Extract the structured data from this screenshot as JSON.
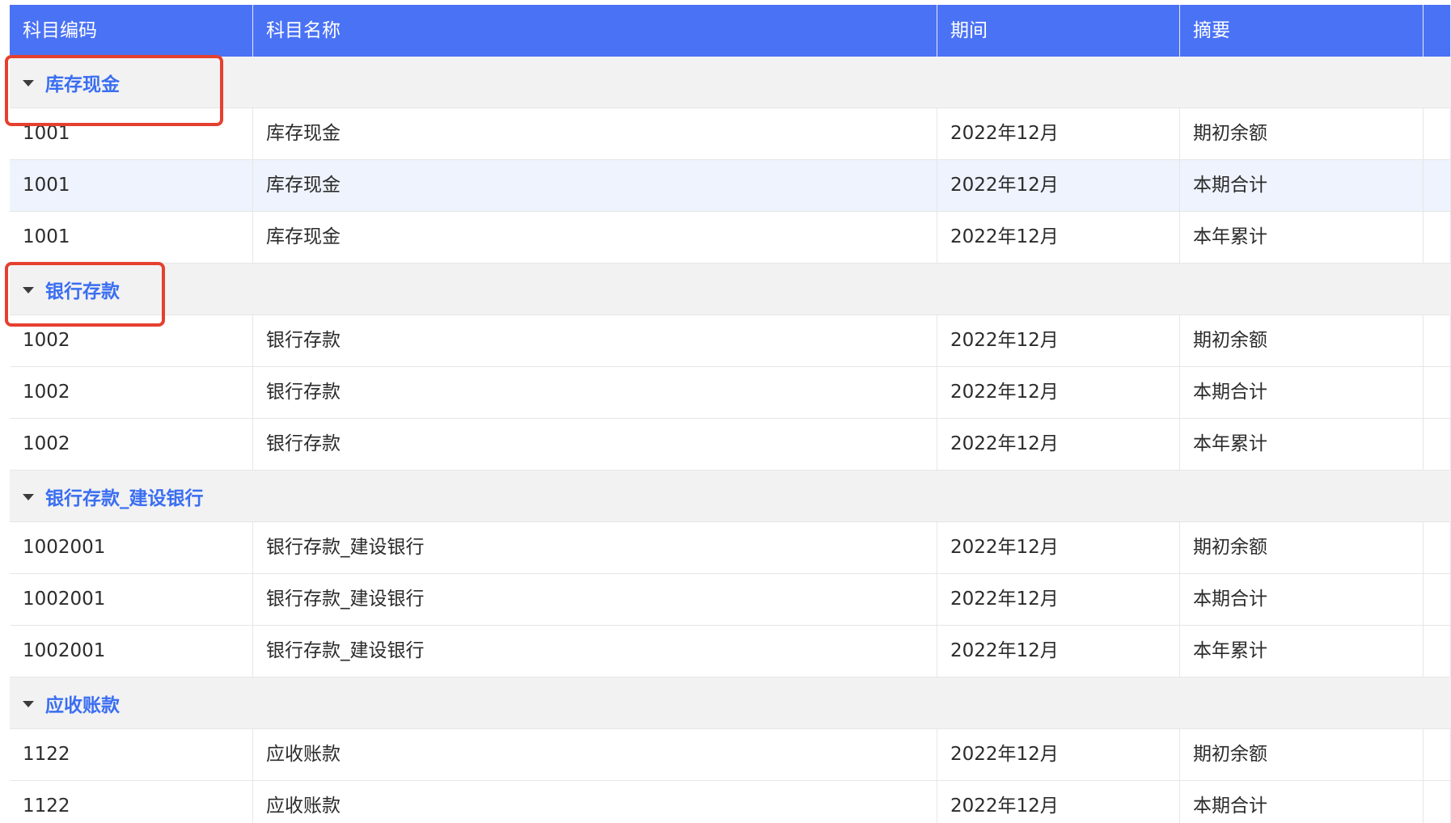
{
  "columns": [
    "科目编码",
    "科目名称",
    "期间",
    "摘要",
    ""
  ],
  "groups": [
    {
      "label": "库存现金",
      "rows": [
        {
          "code": "1001",
          "name": "库存现金",
          "period": "2022年12月",
          "summary": "期初余额"
        },
        {
          "code": "1001",
          "name": "库存现金",
          "period": "2022年12月",
          "summary": "本期合计"
        },
        {
          "code": "1001",
          "name": "库存现金",
          "period": "2022年12月",
          "summary": "本年累计"
        }
      ]
    },
    {
      "label": "银行存款",
      "rows": [
        {
          "code": "1002",
          "name": "银行存款",
          "period": "2022年12月",
          "summary": "期初余额"
        },
        {
          "code": "1002",
          "name": "银行存款",
          "period": "2022年12月",
          "summary": "本期合计"
        },
        {
          "code": "1002",
          "name": "银行存款",
          "period": "2022年12月",
          "summary": "本年累计"
        }
      ]
    },
    {
      "label": "银行存款_建设银行",
      "rows": [
        {
          "code": "1002001",
          "name": "银行存款_建设银行",
          "period": "2022年12月",
          "summary": "期初余额"
        },
        {
          "code": "1002001",
          "name": "银行存款_建设银行",
          "period": "2022年12月",
          "summary": "本期合计"
        },
        {
          "code": "1002001",
          "name": "银行存款_建设银行",
          "period": "2022年12月",
          "summary": "本年累计"
        }
      ]
    },
    {
      "label": "应收账款",
      "rows": [
        {
          "code": "1122",
          "name": "应收账款",
          "period": "2022年12月",
          "summary": "期初余额"
        },
        {
          "code": "1122",
          "name": "应收账款",
          "period": "2022年12月",
          "summary": "本期合计"
        }
      ]
    }
  ],
  "colors": {
    "header_bg": "#4a72f5",
    "group_label": "#3a6ef2",
    "group_bg": "#f2f2f2",
    "highlight_row_bg": "#eef3fd",
    "callout_border": "#e5402f"
  }
}
